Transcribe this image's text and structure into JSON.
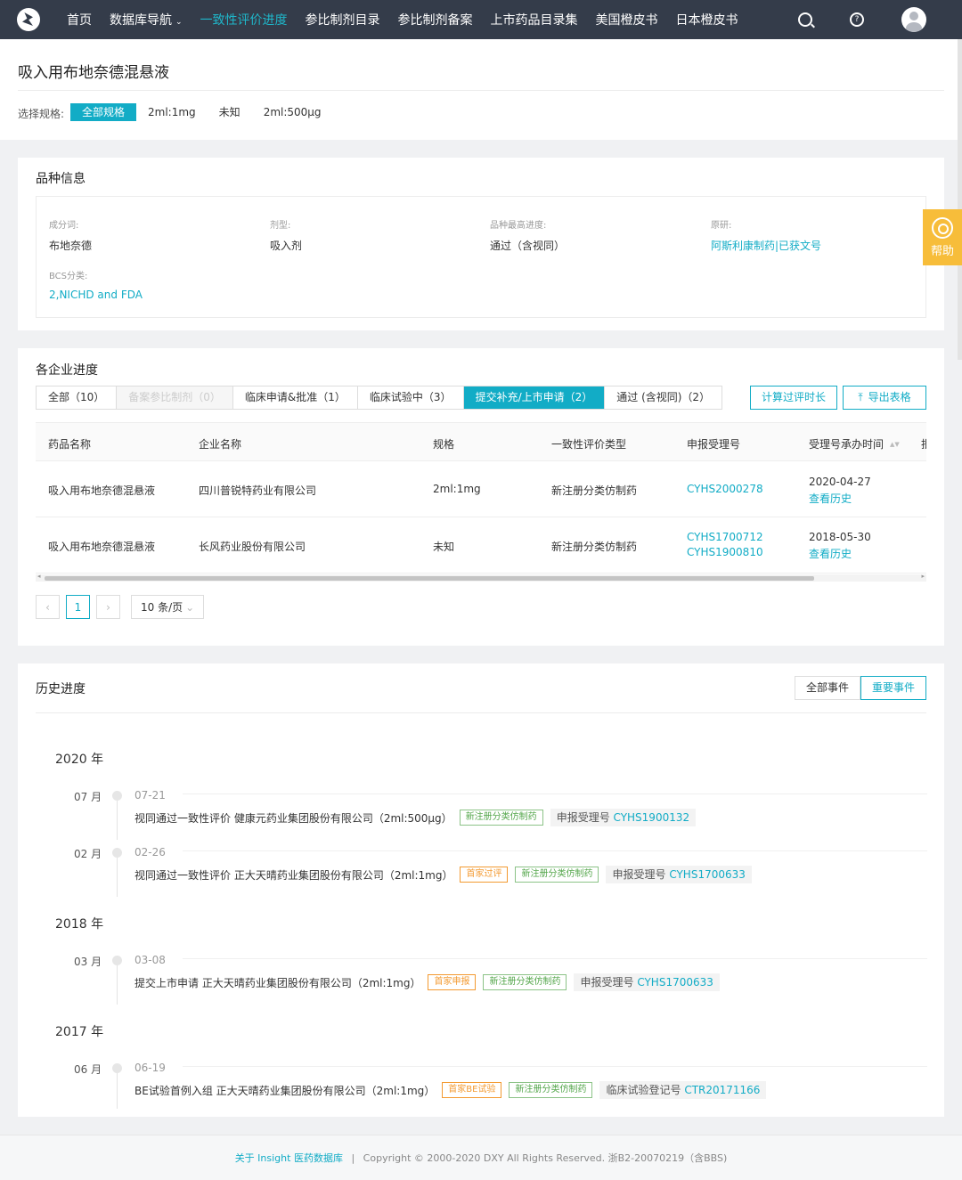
{
  "nav": {
    "items": [
      {
        "label": "首页",
        "active": false
      },
      {
        "label": "数据库导航",
        "active": false,
        "caret": "⌄"
      },
      {
        "label": "一致性评价进度",
        "active": true
      },
      {
        "label": "参比制剂目录",
        "active": false
      },
      {
        "label": "参比制剂备案",
        "active": false
      },
      {
        "label": "上市药品目录集",
        "active": false
      },
      {
        "label": "美国橙皮书",
        "active": false
      },
      {
        "label": "日本橙皮书",
        "active": false
      }
    ],
    "help_icon_glyph": "?",
    "icons": [
      "search-icon",
      "help-circle-icon",
      "avatar"
    ]
  },
  "header": {
    "title": "吸入用布地奈德混悬液",
    "spec_label": "选择规格:",
    "spec_options": [
      "全部规格",
      "2ml:1mg",
      "未知",
      "2ml:500μg"
    ],
    "spec_selected": "全部规格"
  },
  "variety": {
    "title": "品种信息",
    "fields": [
      {
        "label": "成分词:",
        "value": "布地奈德",
        "link": false
      },
      {
        "label": "剂型:",
        "value": "吸入剂",
        "link": false
      },
      {
        "label": "品种最高进度:",
        "value": "通过（含视同）",
        "link": false
      },
      {
        "label": "原研:",
        "value": "阿斯利康制药|已获文号",
        "link": true
      },
      {
        "label": "BCS分类:",
        "value": "2,NICHD and FDA",
        "link": true
      }
    ]
  },
  "progress": {
    "title": "各企业进度",
    "tabs": [
      {
        "label": "全部（10）",
        "state": "normal"
      },
      {
        "label": "备案参比制剂（0）",
        "state": "disabled"
      },
      {
        "label": "临床申请&批准（1）",
        "state": "normal"
      },
      {
        "label": "临床试验中（3）",
        "state": "normal"
      },
      {
        "label": "提交补充/上市申请（2）",
        "state": "active"
      },
      {
        "label": "通过 (含视同)（2）",
        "state": "normal"
      }
    ],
    "btn_calc": "计算过评时长",
    "btn_export": "导出表格",
    "export_icon": "⤒",
    "columns": [
      "药品名称",
      "企业名称",
      "规格",
      "一致性评价类型",
      "申报受理号",
      "受理号承办时间",
      "批"
    ],
    "sort_glyph": "▲▼",
    "rows": [
      {
        "drug": "吸入用布地奈德混悬液",
        "company": "四川普锐特药业有限公司",
        "spec": "2ml:1mg",
        "type": "新注册分类仿制药",
        "nos": [
          "CYHS2000278"
        ],
        "date": "2020-04-27",
        "history": "查看历史"
      },
      {
        "drug": "吸入用布地奈德混悬液",
        "company": "长风药业股份有限公司",
        "spec": "未知",
        "type": "新注册分类仿制药",
        "nos": [
          "CYHS1700712",
          "CYHS1900810"
        ],
        "date": "2018-05-30",
        "history": "查看历史"
      }
    ],
    "scroll_left": "◂",
    "scroll_right": "▸",
    "pager": {
      "prev": "‹",
      "current": "1",
      "next": "›",
      "page_size": "10 条/页",
      "page_size_caret": "⌄"
    }
  },
  "history": {
    "title": "历史进度",
    "filter_all": "全部事件",
    "filter_important": "重要事件",
    "years": [
      {
        "year": "2020 年",
        "months": [
          {
            "month": "07 月",
            "date": "07-21",
            "text": "视同通过一致性评价 健康元药业集团股份有限公司（2ml:500μg）",
            "tags": [
              {
                "label": "新注册分类仿制药",
                "color": "green"
              }
            ],
            "reg_label": "申报受理号",
            "reg_code": "CYHS1900132"
          },
          {
            "month": "02 月",
            "date": "02-26",
            "text": "视同通过一致性评价 正大天晴药业集团股份有限公司（2ml:1mg）",
            "tags": [
              {
                "label": "首家过评",
                "color": "orange"
              },
              {
                "label": "新注册分类仿制药",
                "color": "green"
              }
            ],
            "reg_label": "申报受理号",
            "reg_code": "CYHS1700633"
          }
        ]
      },
      {
        "year": "2018 年",
        "months": [
          {
            "month": "03 月",
            "date": "03-08",
            "text": "提交上市申请 正大天晴药业集团股份有限公司（2ml:1mg）",
            "tags": [
              {
                "label": "首家申报",
                "color": "orange"
              },
              {
                "label": "新注册分类仿制药",
                "color": "green"
              }
            ],
            "reg_label": "申报受理号",
            "reg_code": "CYHS1700633"
          }
        ]
      },
      {
        "year": "2017 年",
        "months": [
          {
            "month": "06 月",
            "date": "06-19",
            "text": "BE试验首例入组 正大天晴药业集团股份有限公司（2ml:1mg）",
            "tags": [
              {
                "label": "首家BE试验",
                "color": "orange"
              },
              {
                "label": "新注册分类仿制药",
                "color": "green"
              }
            ],
            "reg_label": "临床试验登记号",
            "reg_code": "CTR20171166"
          }
        ]
      }
    ]
  },
  "help": {
    "label": "帮助"
  },
  "footer": {
    "link": "关于 Insight 医药数据库",
    "sep": "|",
    "copyright": "Copyright © 2000-2020 DXY All Rights Reserved. 浙B2-20070219（含BBS)"
  },
  "colors": {
    "accent": "#12acc6",
    "nav_bg": "#343c4a",
    "tag_orange": "#f39a31",
    "tag_green": "#53a64a",
    "help_bg": "#f7bd3a"
  }
}
